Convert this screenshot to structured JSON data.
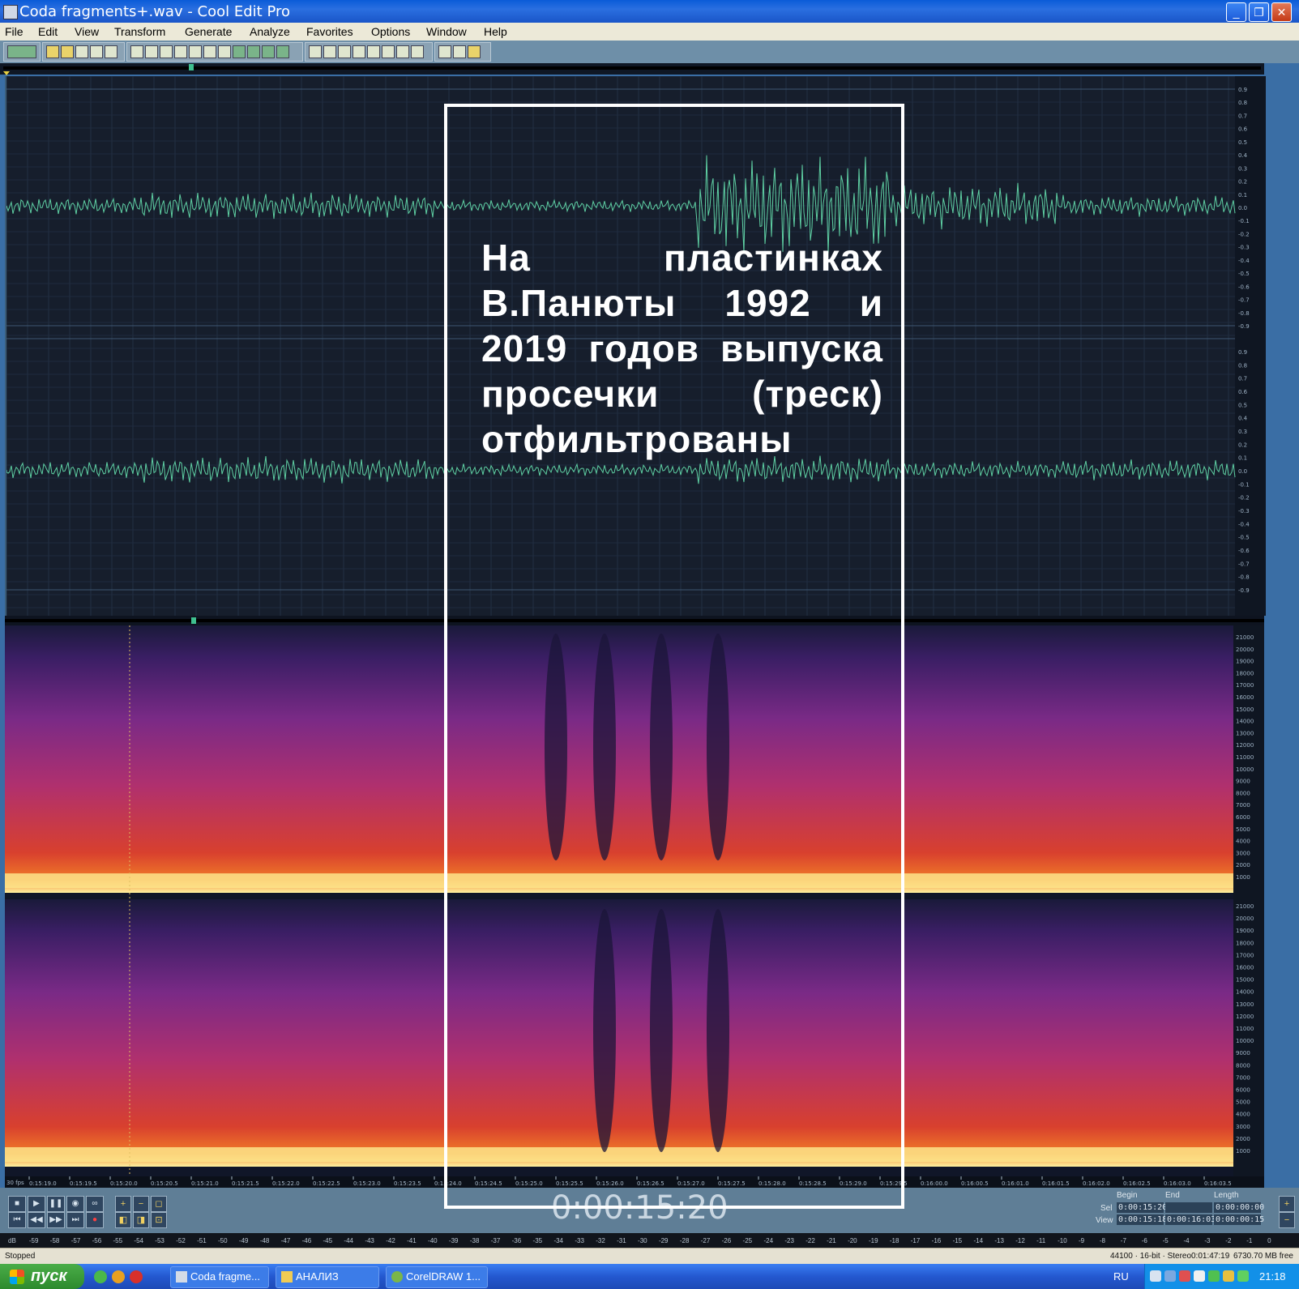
{
  "window": {
    "title": "Coda fragments+.wav - Cool Edit Pro",
    "minimize_glyph": "_",
    "restore_glyph": "❐",
    "close_glyph": "✕"
  },
  "menu": [
    "File",
    "Edit",
    "View",
    "Transform",
    "Generate",
    "Analyze",
    "Favorites",
    "Options",
    "Window",
    "Help"
  ],
  "waveform": {
    "amplitude_ticks": [
      "0.9",
      "0.8",
      "0.7",
      "0.6",
      "0.5",
      "0.4",
      "0.3",
      "0.2",
      "0.1",
      "0.0",
      "-0.1",
      "-0.2",
      "-0.3",
      "-0.4",
      "-0.5",
      "-0.6",
      "-0.7",
      "-0.8",
      "-0.9"
    ]
  },
  "spectral": {
    "freq_ticks": [
      "21000",
      "20000",
      "19000",
      "18000",
      "17000",
      "16000",
      "15000",
      "14000",
      "13000",
      "12000",
      "11000",
      "10000",
      "9000",
      "8000",
      "7000",
      "6000",
      "5000",
      "4000",
      "3000",
      "2000",
      "1000"
    ]
  },
  "ruler": {
    "prefix": "30 fps",
    "labels": [
      "0:15:19.0",
      "0:15:19.5",
      "0:15:20.0",
      "0:15:20.5",
      "0:15:21.0",
      "0:15:21.5",
      "0:15:22.0",
      "0:15:22.5",
      "0:15:23.0",
      "0:15:23.5",
      "0:15:24.0",
      "0:15:24.5",
      "0:15:25.0",
      "0:15:25.5",
      "0:15:26.0",
      "0:15:26.5",
      "0:15:27.0",
      "0:15:27.5",
      "0:15:28.0",
      "0:15:28.5",
      "0:15:29.0",
      "0:15:29.5",
      "0:16:00.0",
      "0:16:00.5",
      "0:16:01.0",
      "0:16:01.5",
      "0:16:02.0",
      "0:16:02.5",
      "0:16:03.0",
      "0:16:03.5"
    ]
  },
  "transport": {
    "buttons": [
      "■",
      "▶",
      "❚❚",
      "◉",
      "∞",
      "⏮",
      "◀◀",
      "▶▶",
      "⏭",
      "●"
    ]
  },
  "time_display": "0:00:15:20",
  "selection": {
    "headers": {
      "begin": "Begin",
      "end": "End",
      "length": "Length"
    },
    "sel": {
      "label": "Sel",
      "begin": "0:00:15:20",
      "end": "",
      "length": "0:00:00:00"
    },
    "view": {
      "label": "View",
      "begin": "0:00:15:18",
      "end": "0:00:16:03",
      "length": "0:00:00:15"
    }
  },
  "level_meter": {
    "labels": [
      "dB",
      "-59",
      "-58",
      "-57",
      "-56",
      "-55",
      "-54",
      "-53",
      "-52",
      "-51",
      "-50",
      "-49",
      "-48",
      "-47",
      "-46",
      "-45",
      "-44",
      "-43",
      "-42",
      "-41",
      "-40",
      "-39",
      "-38",
      "-37",
      "-36",
      "-35",
      "-34",
      "-33",
      "-32",
      "-31",
      "-30",
      "-29",
      "-28",
      "-27",
      "-26",
      "-25",
      "-24",
      "-23",
      "-22",
      "-21",
      "-20",
      "-19",
      "-18",
      "-17",
      "-16",
      "-15",
      "-14",
      "-13",
      "-12",
      "-11",
      "-10",
      "-9",
      "-8",
      "-7",
      "-6",
      "-5",
      "-4",
      "-3",
      "-2",
      "-1",
      "0"
    ]
  },
  "status": {
    "state": "Stopped",
    "format": "44100 · 16-bit · Stereo",
    "duration": "0:01:47:19",
    "free_space": "6730.70 MB free"
  },
  "taskbar": {
    "start_label": "пуск",
    "items": [
      "Coda fragme...",
      "АНАЛИЗ",
      "CorelDRAW 1..."
    ],
    "lang": "RU",
    "clock": "21:18"
  },
  "caption": {
    "lines": [
      "На пластинках",
      "В.Панюты 1992 и",
      "2019 годов выпуска",
      "просечки (треск)",
      "отфильтрованы"
    ]
  }
}
